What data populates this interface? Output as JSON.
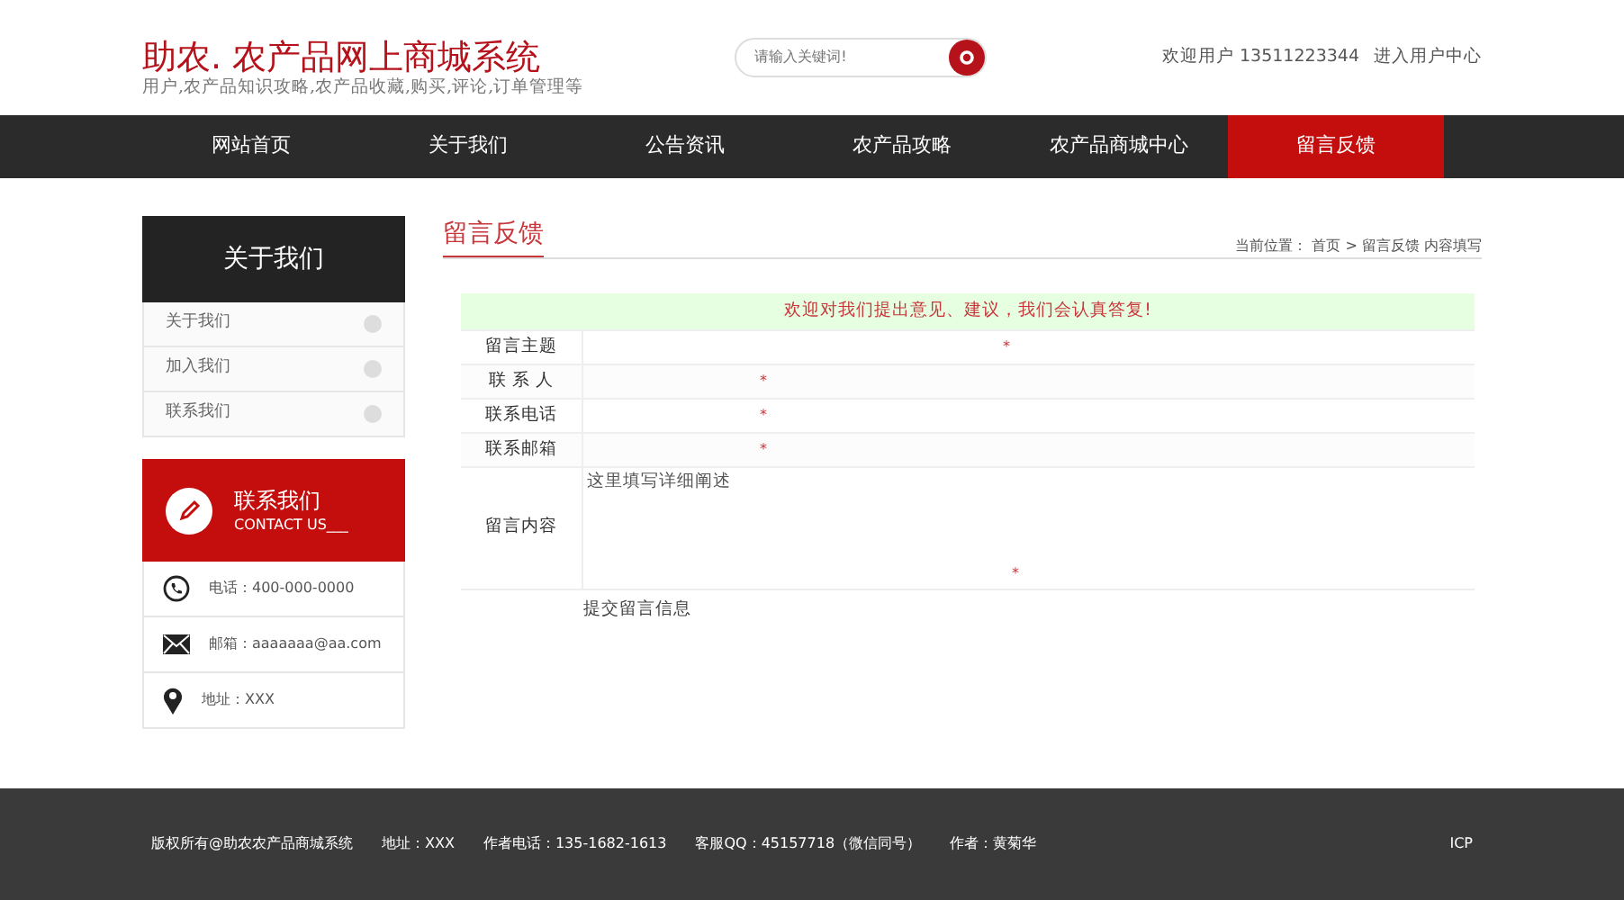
{
  "header": {
    "logo_title": "助农. 农产品网上商城系统",
    "logo_subtitle": "用户,农产品知识攻略,农产品收藏,购买,评论,订单管理等",
    "search": {
      "placeholder": "请输入关键词!"
    },
    "welcome": "欢迎用户 13511223344",
    "user_center_link": "进入用户中心"
  },
  "nav": [
    {
      "label": "网站首页",
      "selected": false
    },
    {
      "label": "关于我们",
      "selected": false
    },
    {
      "label": "公告资讯",
      "selected": false
    },
    {
      "label": "农产品攻略",
      "selected": false
    },
    {
      "label": "农产品商城中心",
      "selected": false
    },
    {
      "label": "留言反馈",
      "selected": true
    }
  ],
  "sidebar": {
    "title": "关于我们",
    "items": [
      {
        "label": "关于我们"
      },
      {
        "label": "加入我们"
      },
      {
        "label": "联系我们"
      }
    ],
    "contact": {
      "title": "联系我们",
      "subtitle": "CONTACT US___",
      "items": [
        {
          "kind": "phone",
          "text": "电话：400-000-0000"
        },
        {
          "kind": "mail",
          "text": "邮箱：aaaaaaa@aa.com"
        },
        {
          "kind": "pin",
          "text": "地址：XXX"
        }
      ]
    }
  },
  "content": {
    "title": "留言反馈",
    "breadcrumb": "当前位置： 首页 > 留言反馈 内容填写",
    "notice": "欢迎对我们提出意见、建议，我们会认真答复!",
    "rows": [
      {
        "label": "留言主题",
        "kind": "wide",
        "required_mark": "*"
      },
      {
        "label": "联 系 人",
        "kind": "short",
        "required_mark": "*"
      },
      {
        "label": "联系电话",
        "kind": "short",
        "required_mark": "*"
      },
      {
        "label": "联系邮箱",
        "kind": "short",
        "required_mark": "*"
      },
      {
        "label": "留言内容",
        "kind": "textarea",
        "placeholder": "这里填写详细阐述",
        "required_mark": "*"
      }
    ],
    "submit": "提交留言信息"
  },
  "footer": [
    "版权所有@助农农产品商城系统",
    "地址：XXX",
    "作者电话：135-1682-1613",
    "客服QQ：45157718（微信同号）",
    "作者：黄菊华"
  ],
  "footer_right": "ICP"
}
